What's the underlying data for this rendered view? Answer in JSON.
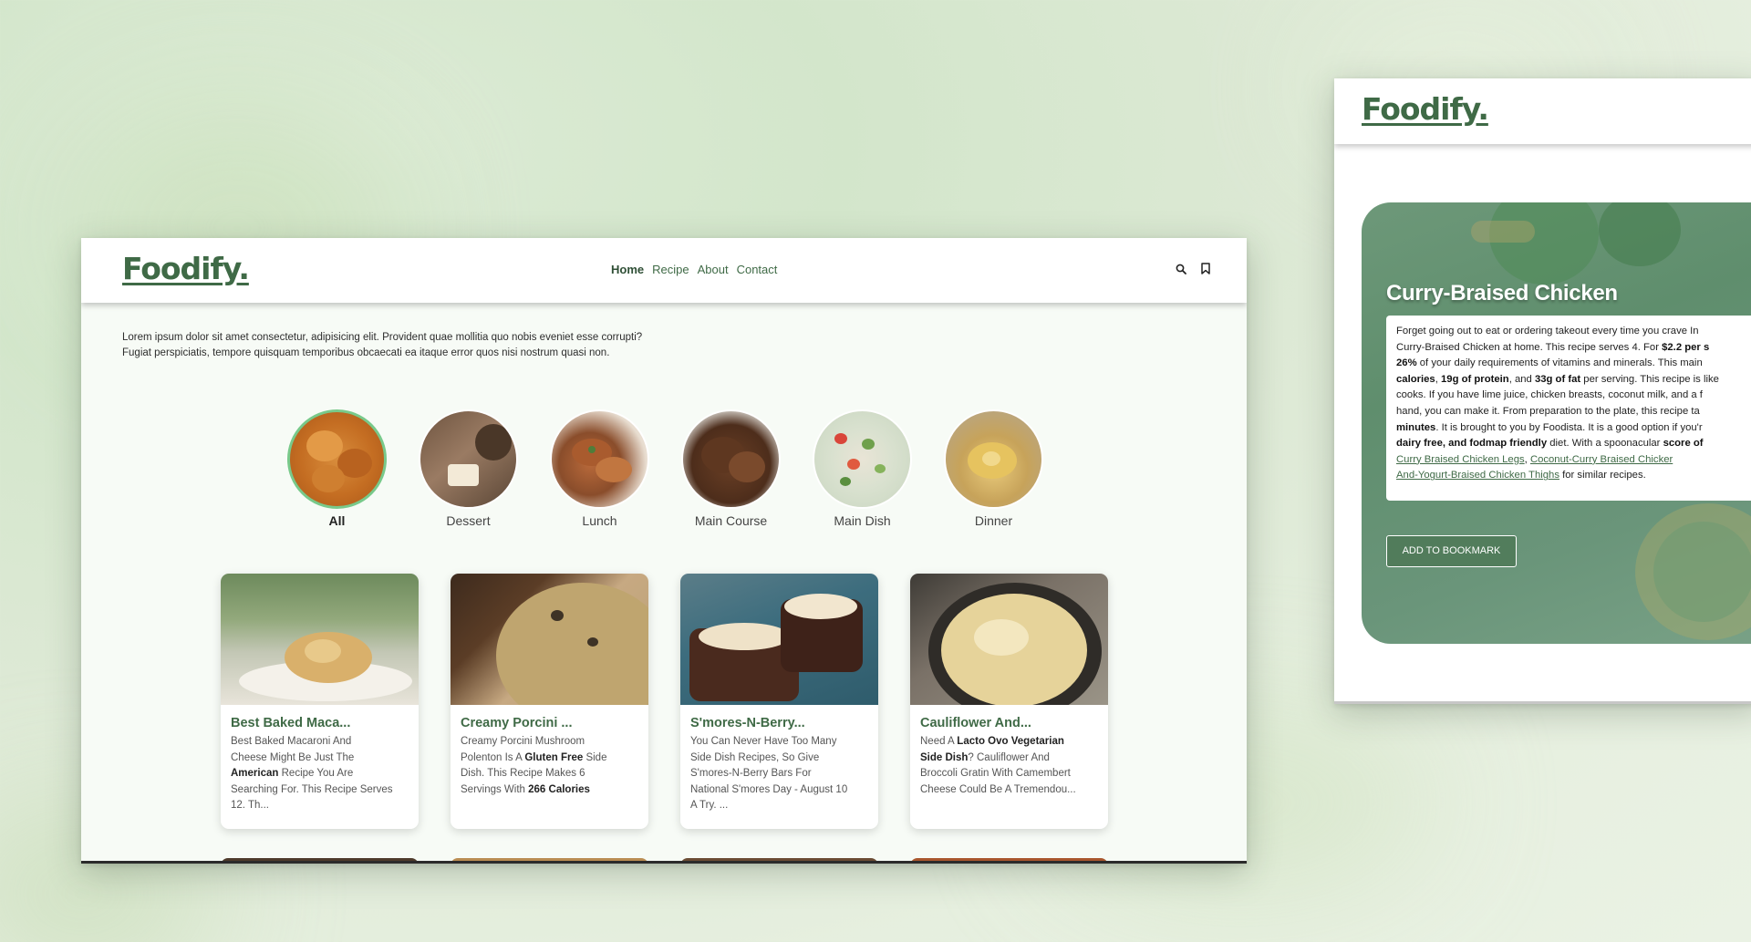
{
  "brand": {
    "logo": "Foodify."
  },
  "nav": {
    "links": [
      {
        "label": "Home",
        "active": true
      },
      {
        "label": "Recipe",
        "active": false
      },
      {
        "label": "About",
        "active": false
      },
      {
        "label": "Contact",
        "active": false
      }
    ],
    "icons": [
      "search-icon",
      "bookmark-icon"
    ]
  },
  "intro": {
    "line1": "Lorem ipsum dolor sit amet consectetur, adipisicing elit. Provident quae mollitia quo nobis eveniet esse corrupti?",
    "line2": "Fugiat perspiciatis, tempore quisquam temporibus obcaecati ea itaque error quos nisi nostrum quasi non."
  },
  "categories": [
    {
      "label": "All",
      "selected": true
    },
    {
      "label": "Dessert",
      "selected": false
    },
    {
      "label": "Lunch",
      "selected": false
    },
    {
      "label": "Main Course",
      "selected": false
    },
    {
      "label": "Main Dish",
      "selected": false
    },
    {
      "label": "Dinner",
      "selected": false
    }
  ],
  "cards": [
    {
      "title": "Best Baked Maca...",
      "desc": [
        {
          "t": "Best Baked Macaroni And"
        },
        {
          "t": "Cheese Might Be Just The"
        },
        {
          "b": "American",
          "t": " Recipe You Are"
        },
        {
          "t": "Searching For. This Recipe Serves"
        },
        {
          "t": "12. Th..."
        }
      ]
    },
    {
      "title": "Creamy Porcini ...",
      "desc": [
        {
          "t": "Creamy Porcini Mushroom"
        },
        {
          "pre": "Polenton Is A ",
          "b": "Gluten Free",
          "t": " Side"
        },
        {
          "t": "Dish. This Recipe Makes 6"
        },
        {
          "pre": "Servings With ",
          "b": "266 Calories",
          "t": ""
        }
      ]
    },
    {
      "title": "S'mores-N-Berry...",
      "desc": [
        {
          "t": "You Can Never Have Too Many"
        },
        {
          "t": "Side Dish Recipes, So Give"
        },
        {
          "t": "S'mores-N-Berry Bars For"
        },
        {
          "t": "National S'mores Day - August 10"
        },
        {
          "t": "A Try. ..."
        }
      ]
    },
    {
      "title": "Cauliflower And...",
      "desc": [
        {
          "pre": "Need A ",
          "b": "Lacto Ovo Vegetarian",
          "t": ""
        },
        {
          "b": "Side Dish",
          "t": "? Cauliflower And"
        },
        {
          "t": "Broccoli Gratin With Camembert"
        },
        {
          "t": "Cheese Could Be A Tremendou..."
        }
      ]
    }
  ],
  "detail": {
    "logo": "Foodify.",
    "title": "Curry-Braised Chicken",
    "button": "ADD TO BOOKMARK",
    "lines": [
      [
        {
          "t": "Forget going out to eat or ordering takeout every time you crave In"
        }
      ],
      [
        {
          "t": "Curry-Braised Chicken at home. This recipe serves 4. For "
        },
        {
          "b": "$2.2 per s"
        }
      ],
      [
        {
          "b": "26%"
        },
        {
          "t": " of your daily requirements of vitamins and minerals. This main"
        }
      ],
      [
        {
          "b": "calories"
        },
        {
          "t": ", "
        },
        {
          "b": "19g of protein"
        },
        {
          "t": ", and "
        },
        {
          "b": "33g of fat"
        },
        {
          "t": " per serving. This recipe is like"
        }
      ],
      [
        {
          "t": "cooks. If you have lime juice, chicken breasts, coconut milk, and a f"
        }
      ],
      [
        {
          "t": "hand, you can make it. From preparation to the plate, this recipe ta"
        }
      ],
      [
        {
          "b": "minutes"
        },
        {
          "t": ". It is brought to you by Foodista. It is a good option if you'r"
        }
      ],
      [
        {
          "b": "dairy free, and fodmap friendly"
        },
        {
          "t": " diet. With a spoonacular "
        },
        {
          "b": "score of"
        }
      ],
      [
        {
          "a": "Curry Braised Chicken Legs"
        },
        {
          "t": ", "
        },
        {
          "a": "Coconut-Curry Braised Chicker"
        }
      ],
      [
        {
          "a": "And-Yogurt-Braised Chicken Thighs"
        },
        {
          "t": " for similar recipes."
        }
      ]
    ]
  },
  "colors": {
    "brand": "#3f6a46",
    "accent": "#78c98a"
  }
}
